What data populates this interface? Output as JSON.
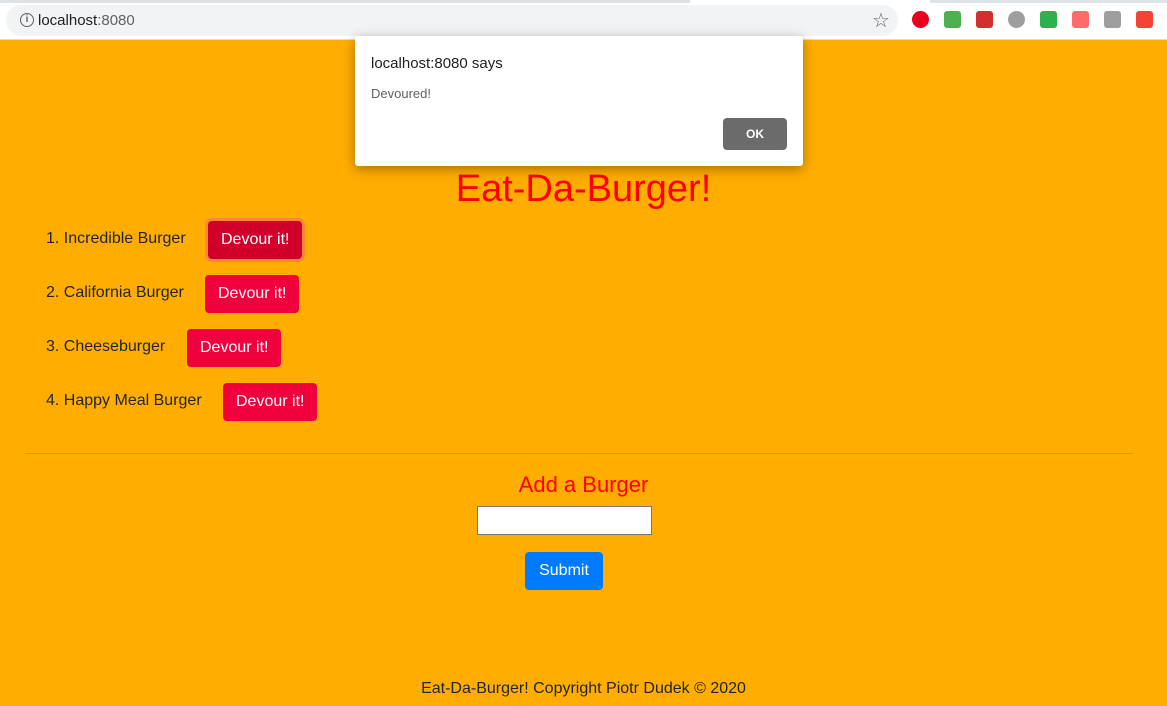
{
  "browser": {
    "url_host": "localhost",
    "url_port": ":8080",
    "info_icon": "info-icon",
    "bookmark_icon": "star-icon",
    "extensions": [
      {
        "name": "adblock-extension-icon",
        "color": "#e8001c"
      },
      {
        "name": "rainbow-extension-icon",
        "color": "#4caf50"
      },
      {
        "name": "bookmark-extension-icon",
        "color": "#d32f2f"
      },
      {
        "name": "chat-extension-icon",
        "color": "#9e9e9e"
      },
      {
        "name": "feedly-extension-icon",
        "color": "#2bb24c"
      },
      {
        "name": "cast-extension-icon",
        "color": "#ff6b6b"
      },
      {
        "name": "translate-extension-icon",
        "color": "#9e9e9e"
      },
      {
        "name": "off-extension-icon",
        "color": "#f44336"
      }
    ]
  },
  "alert": {
    "title": "localhost:8080 says",
    "message": "Devoured!",
    "ok_label": "OK"
  },
  "page": {
    "title": "Eat-Da-Burger!",
    "burgers": [
      {
        "number": "1.",
        "name": "Incredible Burger",
        "button": "Devour it!"
      },
      {
        "number": "2.",
        "name": "California Burger",
        "button": "Devour it!"
      },
      {
        "number": "3.",
        "name": "Cheeseburger",
        "button": "Devour it!"
      },
      {
        "number": "4.",
        "name": "Happy Meal Burger",
        "button": "Devour it!"
      }
    ],
    "add_heading": "Add a Burger",
    "input_value": "",
    "submit_label": "Submit",
    "footer": "Eat-Da-Burger! Copyright Piotr Dudek © 2020"
  },
  "colors": {
    "background": "#ffad00",
    "title": "#ff0000",
    "devour_button": "#f0003c",
    "submit_button": "#007bff"
  }
}
